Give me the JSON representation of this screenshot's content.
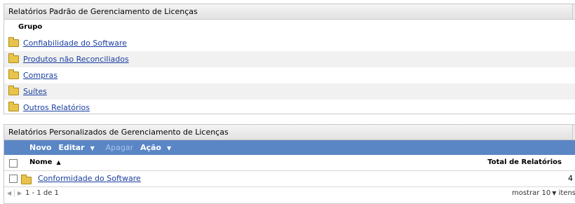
{
  "panel1": {
    "title": "Relatórios Padrão de Gerenciamento de Licenças",
    "column_header": "Grupo",
    "rows": [
      {
        "label": "Confiabilidade do Software"
      },
      {
        "label": "Produtos não Reconciliados"
      },
      {
        "label": "Compras"
      },
      {
        "label": "Suítes"
      },
      {
        "label": "Outros Relatórios"
      }
    ]
  },
  "panel2": {
    "title": "Relatórios Personalizados de Gerenciamento de Licenças",
    "toolbar": {
      "new": "Novo",
      "edit": "Editar",
      "delete": "Apagar",
      "action": "Ação"
    },
    "columns": {
      "name": "Nome",
      "total": "Total de Relatórios"
    },
    "rows": [
      {
        "name": "Conformidade do Software",
        "total": "4"
      }
    ],
    "pager": {
      "range": "1 - 1 de 1",
      "show_label": "mostrar",
      "page_size": "10",
      "items_label": "itens"
    }
  },
  "icons": {
    "folder": "folder-icon",
    "caret": "chevron-down-icon",
    "sort": "sort-ascending-icon"
  },
  "colors": {
    "toolbar_bg": "#5a86c5",
    "link": "#1a3fa0",
    "folder": "#e8c44a"
  }
}
